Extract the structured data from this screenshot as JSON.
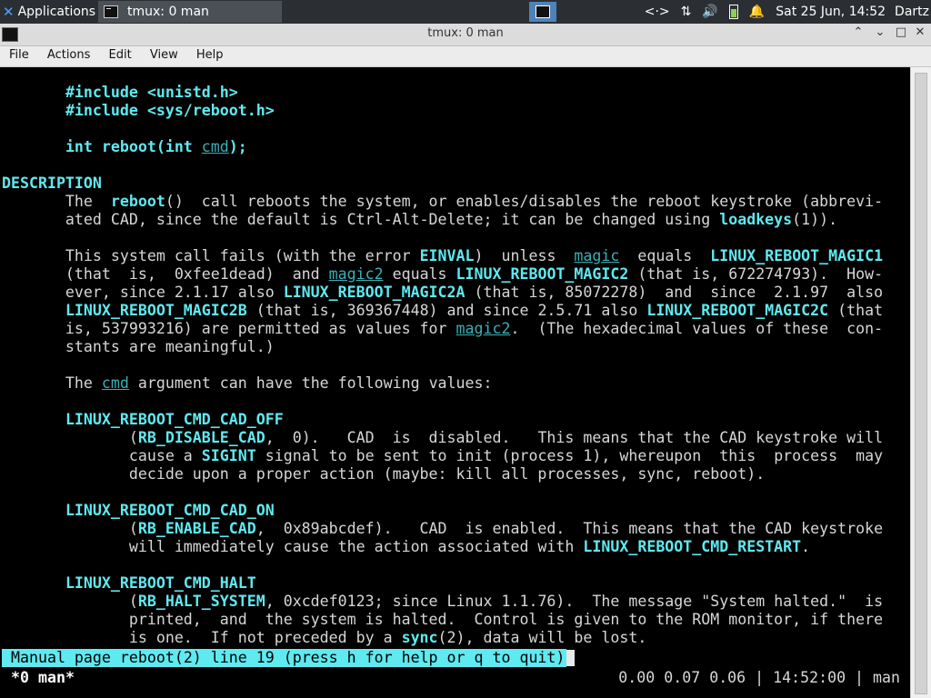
{
  "panel": {
    "applications_label": "Applications",
    "task_label": "tmux: 0 man",
    "tray": {
      "network_icon": "<·>",
      "transfer_icon": "⇅",
      "volume_icon": "🔊",
      "notifications_icon": "🔔",
      "clock": "Sat 25 Jun, 14:52",
      "user": "Dartz"
    }
  },
  "window": {
    "title": "tmux: 0 man",
    "minimize_icon": "⌃",
    "restore_icon": "⌄",
    "maximize_icon": "□",
    "close_icon": "✕"
  },
  "menubar": [
    "File",
    "Actions",
    "Edit",
    "View",
    "Help"
  ],
  "terminal": {
    "lines": [
      [
        [
          "n",
          "       "
        ],
        [
          "b",
          "#include <unistd.h>"
        ]
      ],
      [
        [
          "n",
          "       "
        ],
        [
          "b",
          "#include <sys/reboot.h>"
        ]
      ],
      [],
      [
        [
          "n",
          "       "
        ],
        [
          "b",
          "int reboot(int "
        ],
        [
          "u",
          "cmd"
        ],
        [
          "b",
          ");"
        ]
      ],
      [],
      [
        [
          "b",
          "DESCRIPTION"
        ]
      ],
      [
        [
          "n",
          "       The  "
        ],
        [
          "b",
          "reboot"
        ],
        [
          "n",
          "()  call reboots the system, or enables/disables the reboot keystroke (abbrevi-"
        ]
      ],
      [
        [
          "n",
          "       ated CAD, since the default is Ctrl-Alt-Delete; it can be changed using "
        ],
        [
          "b",
          "loadkeys"
        ],
        [
          "n",
          "(1))."
        ]
      ],
      [],
      [
        [
          "n",
          "       This system call fails (with the error "
        ],
        [
          "b",
          "EINVAL"
        ],
        [
          "n",
          ")  unless  "
        ],
        [
          "u",
          "magic"
        ],
        [
          "n",
          "  equals  "
        ],
        [
          "b",
          "LINUX_REBOOT_MAGIC1"
        ]
      ],
      [
        [
          "n",
          "       (that  is,  0xfee1dead)  and "
        ],
        [
          "u",
          "magic2"
        ],
        [
          "n",
          " equals "
        ],
        [
          "b",
          "LINUX_REBOOT_MAGIC2"
        ],
        [
          "n",
          " (that is, 672274793).  How-"
        ]
      ],
      [
        [
          "n",
          "       ever, since 2.1.17 also "
        ],
        [
          "b",
          "LINUX_REBOOT_MAGIC2A"
        ],
        [
          "n",
          " (that is, 85072278)  and  since  2.1.97  also"
        ]
      ],
      [
        [
          "n",
          "       "
        ],
        [
          "b",
          "LINUX_REBOOT_MAGIC2B"
        ],
        [
          "n",
          " (that is, 369367448) and since 2.5.71 also "
        ],
        [
          "b",
          "LINUX_REBOOT_MAGIC2C"
        ],
        [
          "n",
          " (that"
        ]
      ],
      [
        [
          "n",
          "       is, 537993216) are permitted as values for "
        ],
        [
          "u",
          "magic2"
        ],
        [
          "n",
          ".  (The hexadecimal values of these  con-"
        ]
      ],
      [
        [
          "n",
          "       stants are meaningful.)"
        ]
      ],
      [],
      [
        [
          "n",
          "       The "
        ],
        [
          "u",
          "cmd"
        ],
        [
          "n",
          " argument can have the following values:"
        ]
      ],
      [],
      [
        [
          "n",
          "       "
        ],
        [
          "b",
          "LINUX_REBOOT_CMD_CAD_OFF"
        ]
      ],
      [
        [
          "n",
          "              ("
        ],
        [
          "b",
          "RB_DISABLE_CAD"
        ],
        [
          "n",
          ",  0).   CAD  is  disabled.   This means that the CAD keystroke will"
        ]
      ],
      [
        [
          "n",
          "              cause a "
        ],
        [
          "b",
          "SIGINT"
        ],
        [
          "n",
          " signal to be sent to init (process 1), whereupon  this  process  may"
        ]
      ],
      [
        [
          "n",
          "              decide upon a proper action (maybe: kill all processes, sync, reboot)."
        ]
      ],
      [],
      [
        [
          "n",
          "       "
        ],
        [
          "b",
          "LINUX_REBOOT_CMD_CAD_ON"
        ]
      ],
      [
        [
          "n",
          "              ("
        ],
        [
          "b",
          "RB_ENABLE_CAD"
        ],
        [
          "n",
          ",  0x89abcdef).   CAD  is enabled.  This means that the CAD keystroke"
        ]
      ],
      [
        [
          "n",
          "              will immediately cause the action associated with "
        ],
        [
          "b",
          "LINUX_REBOOT_CMD_RESTART"
        ],
        [
          "n",
          "."
        ]
      ],
      [],
      [
        [
          "n",
          "       "
        ],
        [
          "b",
          "LINUX_REBOOT_CMD_HALT"
        ]
      ],
      [
        [
          "n",
          "              ("
        ],
        [
          "b",
          "RB_HALT_SYSTEM"
        ],
        [
          "n",
          ", 0xcdef0123; since Linux 1.1.76).  The message \"System halted.\"  is"
        ]
      ],
      [
        [
          "n",
          "              printed,  and  the system is halted.  Control is given to the ROM monitor, if there"
        ]
      ],
      [
        [
          "n",
          "              is one.  If not preceded by a "
        ],
        [
          "b",
          "sync"
        ],
        [
          "n",
          "(2), data will be lost."
        ]
      ]
    ],
    "status_line": "Manual page reboot(2) line 19 (press h for help or q to quit)",
    "tmux_left": "*0 man*",
    "tmux_right": "0.00 0.07 0.06 | 14:52:00 | man"
  },
  "colors": {
    "bold_cyan": "#5fe9f0",
    "underline_cyan": "#3ab0b5",
    "text": "#d6d6d6",
    "status_bg": "#5fe9f0"
  }
}
